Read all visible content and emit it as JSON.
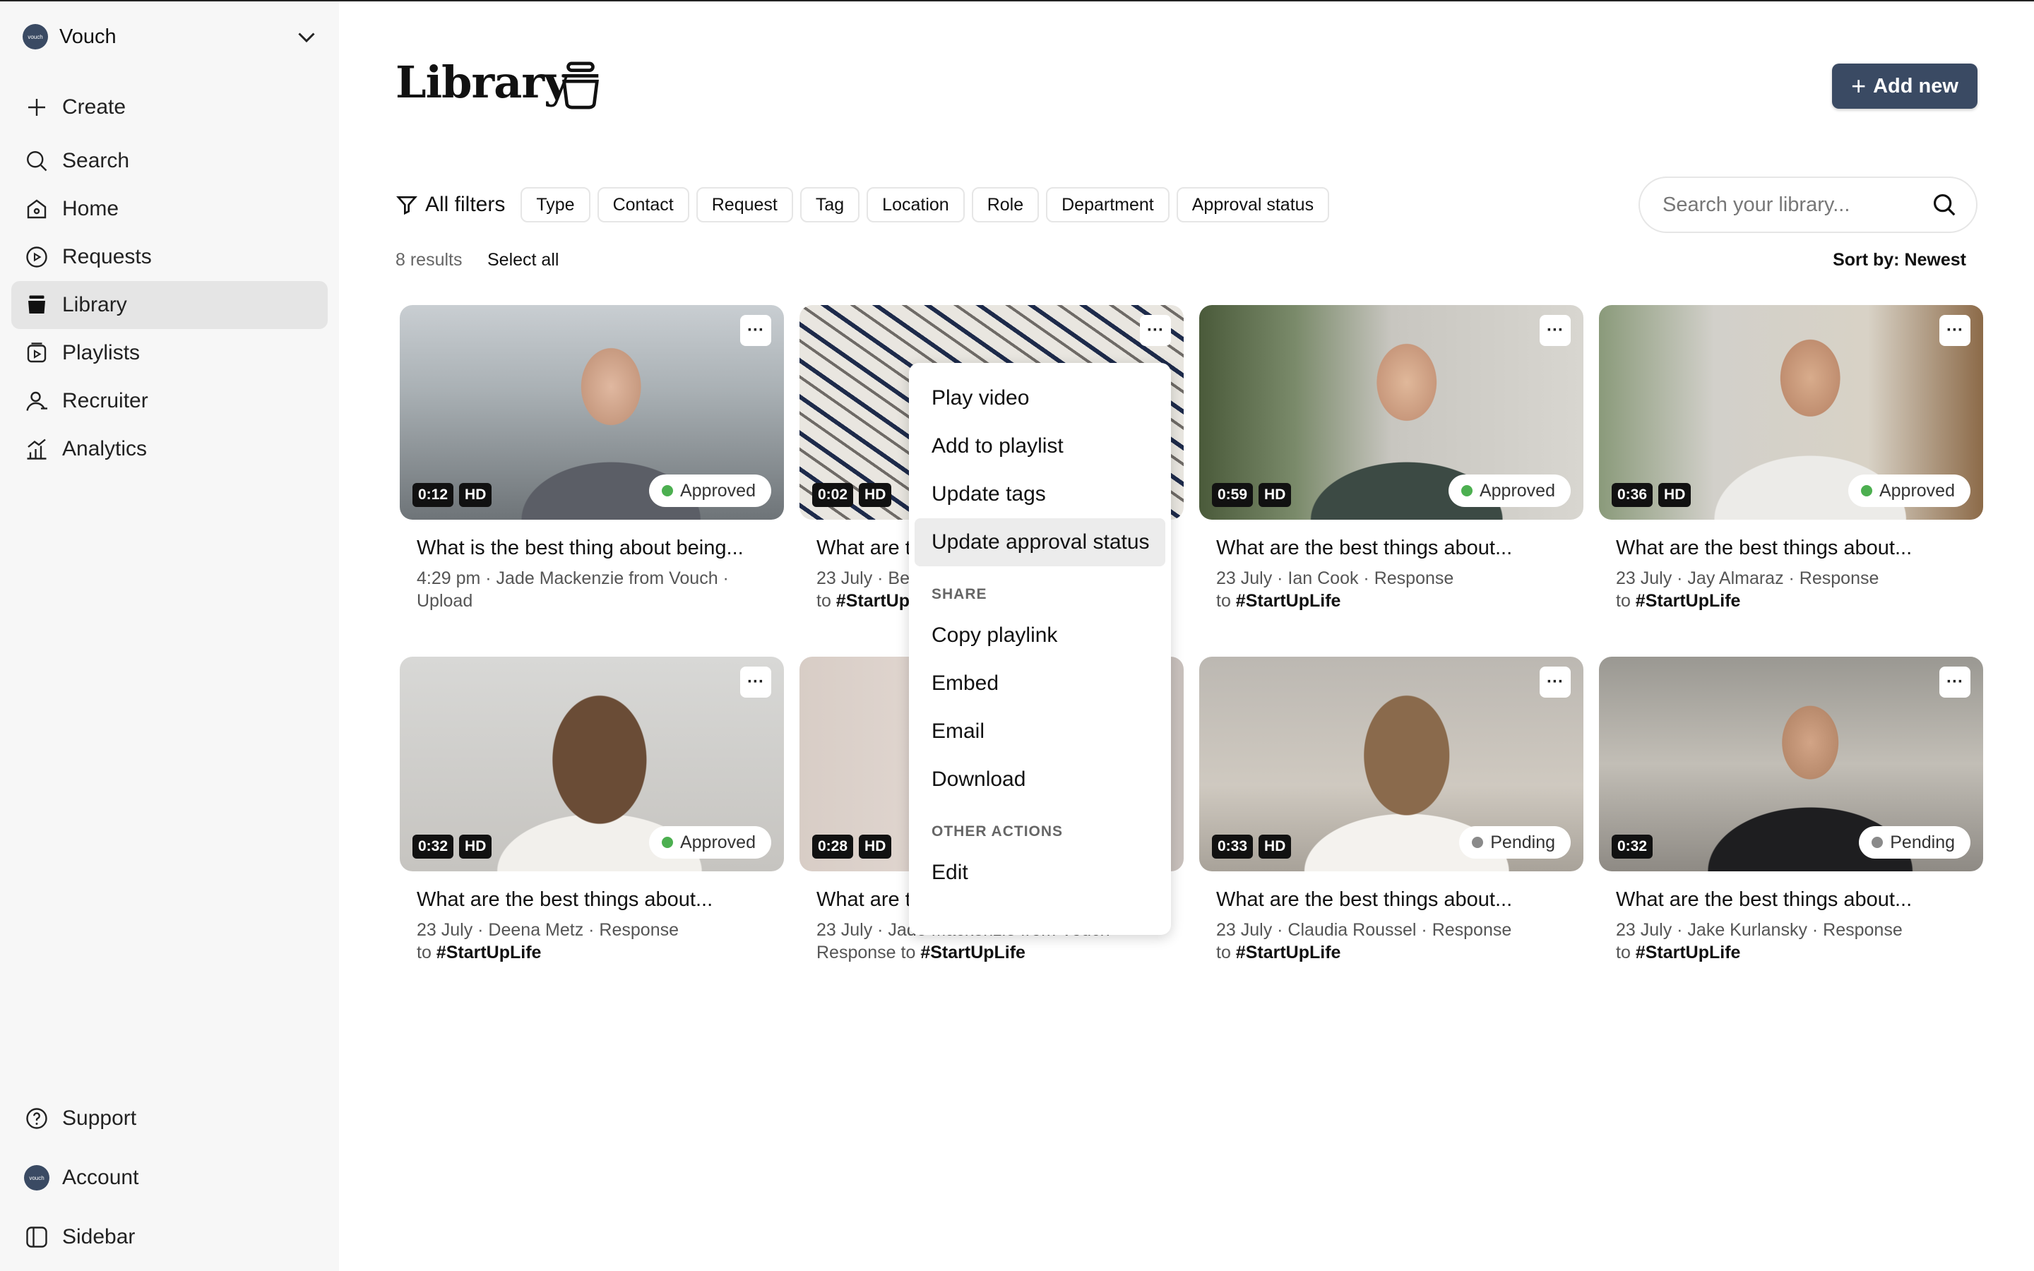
{
  "org": {
    "name": "Vouch",
    "logo_text": "vouch"
  },
  "nav": {
    "create": "Create",
    "search": "Search",
    "home": "Home",
    "requests": "Requests",
    "library": "Library",
    "playlists": "Playlists",
    "recruiter": "Recruiter",
    "analytics": "Analytics",
    "support": "Support",
    "account": "Account",
    "sidebar": "Sidebar"
  },
  "header": {
    "title": "Library",
    "add_new": "Add new"
  },
  "filters": {
    "all": "All filters",
    "chips": [
      "Type",
      "Contact",
      "Request",
      "Tag",
      "Location",
      "Role",
      "Department",
      "Approval status"
    ]
  },
  "search": {
    "placeholder": "Search your library..."
  },
  "results": {
    "count": "8 results",
    "select_all": "Select all",
    "sort": "Sort by: Newest"
  },
  "videos": [
    {
      "duration": "0:12",
      "hd": "HD",
      "status": "Approved",
      "title": "What is the best thing about being...",
      "meta": "4:29 pm · Jade Mackenzie from Vouch · Upload",
      "tag": ""
    },
    {
      "duration": "0:02",
      "hd": "HD",
      "status": "",
      "title": "What are t",
      "meta": "23 July · Be",
      "tag": "#StartUp"
    },
    {
      "duration": "0:59",
      "hd": "HD",
      "status": "Approved",
      "title": "What are the best things about...",
      "meta": "23 July · Ian Cook · Response",
      "tag": "#StartUpLife"
    },
    {
      "duration": "0:36",
      "hd": "HD",
      "status": "Approved",
      "title": "What are the best things about...",
      "meta": "23 July · Jay Almaraz · Response",
      "tag": "#StartUpLife"
    },
    {
      "duration": "0:32",
      "hd": "HD",
      "status": "Approved",
      "title": "What are the best things about...",
      "meta": "23 July · Deena Metz · Response",
      "tag": "#StartUpLife"
    },
    {
      "duration": "0:28",
      "hd": "HD",
      "status": "",
      "title": "What are t",
      "meta": "23 July · Jade Mackenzie from Vouch",
      "tag": "#StartUpLife"
    },
    {
      "duration": "0:33",
      "hd": "HD",
      "status": "Pending",
      "title": "What are the best things about...",
      "meta": "23 July · Claudia Roussel · Response",
      "tag": "#StartUpLife"
    },
    {
      "duration": "0:32",
      "hd": "",
      "status": "Pending",
      "title": "What are the best things about...",
      "meta": "23 July · Jake Kurlansky · Response",
      "tag": "#StartUpLife"
    }
  ],
  "context_menu": {
    "play": "Play video",
    "add_playlist": "Add to playlist",
    "update_tags": "Update tags",
    "update_approval": "Update approval status",
    "share_section": "SHARE",
    "copy": "Copy playlink",
    "embed": "Embed",
    "email": "Email",
    "download": "Download",
    "other_section": "OTHER ACTIONS",
    "edit": "Edit"
  },
  "colors": {
    "accent": "#3a4a63",
    "approved": "#4caf50",
    "pending": "#8a8a8a"
  }
}
